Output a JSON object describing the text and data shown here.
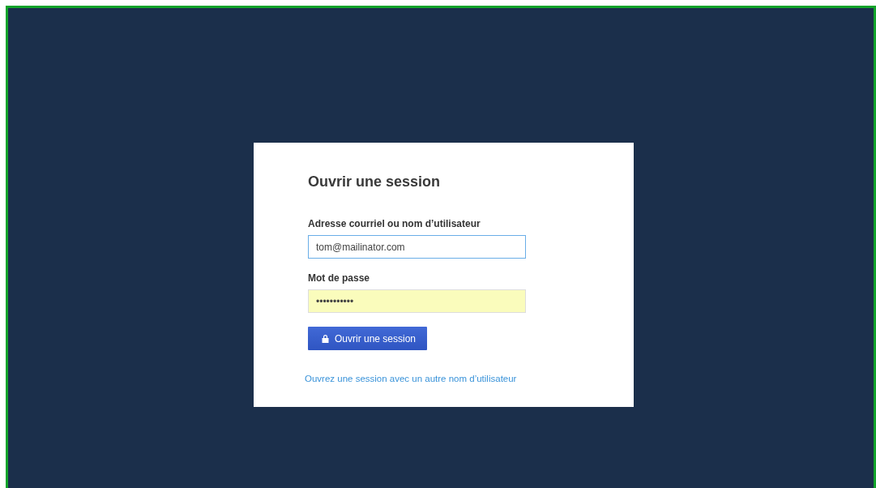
{
  "title": "Ouvrir une session",
  "fields": [
    {
      "label": "Adresse courriel ou nom d’utilisateur",
      "value": "tom@mailinator.com",
      "kind": "focused"
    },
    {
      "label": "Mot de passe",
      "value": "•••••••••••",
      "kind": "autofilled"
    }
  ],
  "submit_button": {
    "label": "Ouvrir une session"
  },
  "alt_link": "Ouvrez une session avec un autre nom d’utilisateur"
}
